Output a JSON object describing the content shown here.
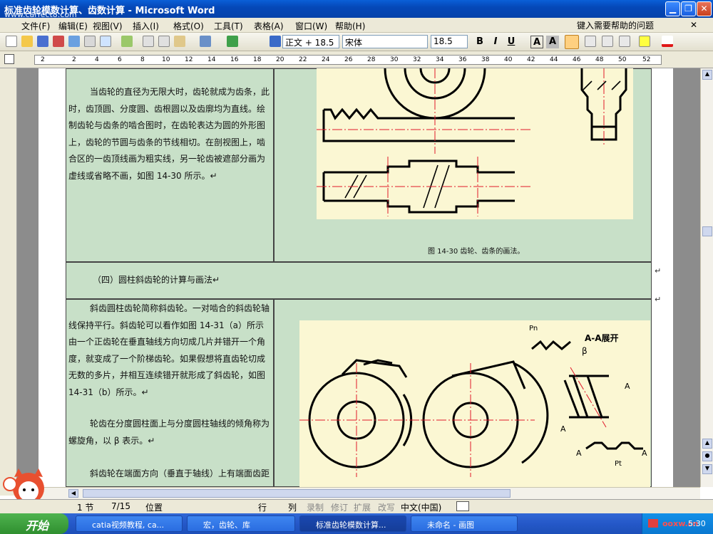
{
  "window": {
    "title": "标准齿轮模数计算、齿数计算 - Microsoft Word",
    "watermark": "www.carfect8.com"
  },
  "menu": {
    "items": [
      "文件(F)",
      "编辑(E)",
      "视图(V)",
      "插入(I)",
      "格式(O)",
      "工具(T)",
      "表格(A)",
      "窗口(W)",
      "帮助(H)"
    ],
    "help_placeholder": "键入需要帮助的问题"
  },
  "toolbar": {
    "style": "正文 + 18.5",
    "font": "宋体",
    "size": "18.5",
    "bold": "B",
    "italic": "I",
    "underline": "U",
    "charbox": "A",
    "charshade": "A"
  },
  "ruler": {
    "ticks": [
      "2",
      "2",
      "4",
      "6",
      "8",
      "10",
      "12",
      "14",
      "16",
      "18",
      "20",
      "22",
      "24",
      "26",
      "28",
      "30",
      "32",
      "34",
      "36",
      "38",
      "40",
      "42",
      "44",
      "46",
      "48",
      "50",
      "52"
    ]
  },
  "document": {
    "para1": "当齿轮的直径为无限大时，齿轮就成为齿条，此时，齿顶圆、分度圆、齿根圆以及齿廓均为直线。绘制齿轮与齿条的啮合图时，在齿轮表达为圆的外形图上，齿轮的节圆与齿条的节线相切。在剖视图上，啮合区的一齿顶线画为粗实线，另一轮齿被遮部分画为虚线或省略不画，如图 14-30 所示。↵",
    "fig1_caption": "图 14-30 齿轮、齿条的画法。",
    "heading": "（四）圆柱斜齿轮的计算与画法↵",
    "para2": "斜齿圆柱齿轮简称斜齿轮。一对啮合的斜齿轮轴线保持平行。斜齿轮可以看作如图 14-31（a）所示由一个正齿轮在垂直轴线方向切成几片并错开一个角度，就变成了一个阶梯齿轮。如果假想将直齿轮切成无数的多片，并相互连续错开就形成了斜齿轮，如图 14-31（b）所示。↵",
    "para3": "轮齿在分度圆柱面上与分度圆柱轴线的倾角称为螺旋角，以 β 表示。↵",
    "para4": "斜齿轮在端面方向（垂直于轴线）上有端面齿距",
    "fig2_labels": {
      "pn": "Pn",
      "aa": "A-A展开",
      "beta": "β",
      "a": "A",
      "pt": "Pt"
    }
  },
  "status": {
    "section": "1 节",
    "page": "7/15",
    "position": "位置",
    "line": "行",
    "col": "列",
    "rec": "录制",
    "trk": "修订",
    "ext": "扩展",
    "ovr": "改写",
    "lang": "中文(中国)"
  },
  "taskbar": {
    "start": "开始",
    "tasks": [
      "catia视频教程, ca...",
      "宏，齿轮、库",
      "标准齿轮模数计算...",
      "未命名 - 画图"
    ],
    "clock": "5:30",
    "tray_text": "ooxw.cn"
  },
  "colors": {
    "title": "#0a5fd8",
    "cell": "#c8e0c8",
    "figure": "#fbf7d3",
    "centerline": "#e0182a"
  }
}
